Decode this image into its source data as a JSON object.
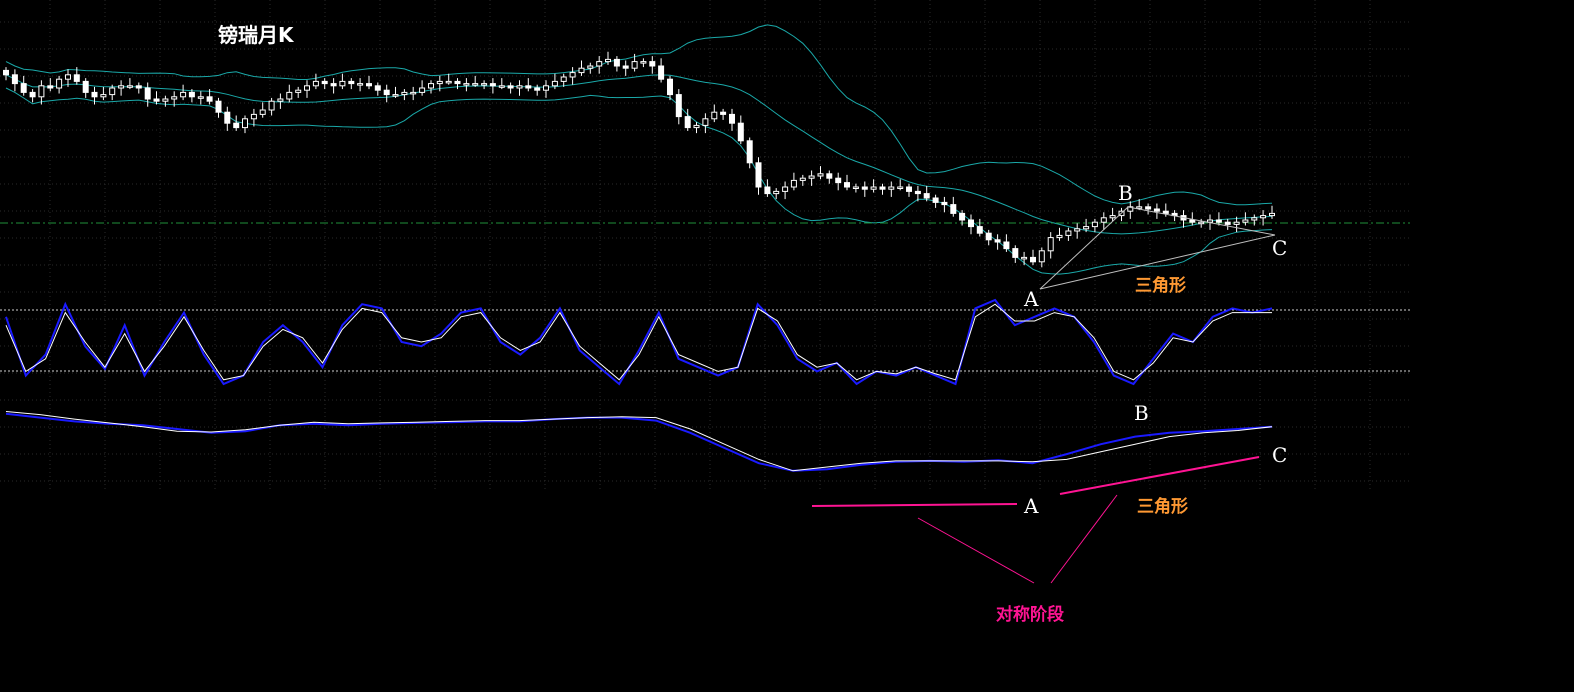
{
  "title": "镑瑞月K",
  "annotations": {
    "triangle_label": "三角形",
    "symmetry_label": "对称阶段",
    "point_a": "A",
    "point_b": "B",
    "point_c": "C"
  },
  "colors": {
    "background": "#000000",
    "candle": "#ffffff",
    "bollinger": "#1aa8a8",
    "grid": "#2a2a2a",
    "reference_line": "#1f8f3a",
    "kd_fast": "#1a1aff",
    "kd_slow": "#ffffff",
    "triangle_label": "#ff9933",
    "symmetry": "#ff1493"
  },
  "chart_data": [
    {
      "type": "candlestick",
      "panel": "price",
      "indicators": [
        "bollinger_bands"
      ],
      "grid": true,
      "horizontal_reference": "dash-dot",
      "close": [
        66,
        62,
        58,
        56,
        61,
        60,
        64,
        66,
        63,
        58,
        56,
        57,
        60,
        61,
        61,
        60,
        55,
        54,
        55,
        56,
        58,
        56,
        56,
        54,
        49,
        44,
        42,
        46,
        48,
        50,
        54,
        55,
        58,
        59,
        61,
        63,
        62,
        61,
        63,
        62,
        62,
        61,
        59,
        57,
        57,
        58,
        58,
        60,
        62,
        63,
        63,
        62,
        62,
        62,
        62,
        61,
        61,
        60,
        61,
        60,
        59,
        61,
        63,
        65,
        67,
        69,
        70,
        72,
        73,
        70,
        69,
        72,
        72,
        70,
        64,
        57,
        47,
        42,
        43,
        46,
        49,
        48,
        44,
        36,
        26,
        15,
        12,
        13,
        15,
        18,
        19,
        20,
        21,
        19,
        17,
        15,
        15,
        14,
        15,
        14,
        15,
        15,
        13,
        12,
        10,
        8,
        7,
        3,
        0,
        -3,
        -6,
        -9,
        -10,
        -13,
        -17,
        -17,
        -19,
        -14,
        -8,
        -7,
        -5,
        -4,
        -3,
        -1,
        1,
        2,
        4,
        6,
        6,
        5,
        4,
        3,
        2,
        0,
        -1,
        -1,
        0,
        -1,
        -2,
        -1,
        0,
        1,
        2,
        3
      ]
    },
    {
      "type": "line",
      "panel": "kd_oscillator",
      "series": [
        {
          "values": [
            0.8,
            0.1,
            0.35,
            0.95,
            0.45,
            0.18,
            0.7,
            0.1,
            0.5,
            0.85,
            0.35,
            0.0,
            0.1,
            0.5,
            0.7,
            0.5,
            0.2,
            0.7,
            0.95,
            0.9,
            0.5,
            0.45,
            0.6,
            0.85,
            0.9,
            0.5,
            0.35,
            0.55,
            0.9,
            0.4,
            0.2,
            0.0,
            0.4,
            0.85,
            0.3,
            0.2,
            0.1,
            0.2,
            0.95,
            0.7,
            0.3,
            0.15,
            0.25,
            0.0,
            0.15,
            0.1,
            0.2,
            0.1,
            0.0,
            0.9,
            1.0,
            0.7,
            0.8,
            0.9,
            0.8,
            0.5,
            0.1,
            0.0,
            0.3,
            0.6,
            0.5,
            0.8,
            0.9,
            0.85,
            0.9
          ]
        },
        {
          "values": [
            0.7,
            0.15,
            0.3,
            0.85,
            0.5,
            0.2,
            0.6,
            0.15,
            0.45,
            0.8,
            0.4,
            0.05,
            0.1,
            0.45,
            0.65,
            0.55,
            0.25,
            0.65,
            0.9,
            0.85,
            0.55,
            0.5,
            0.55,
            0.8,
            0.85,
            0.55,
            0.4,
            0.5,
            0.85,
            0.45,
            0.25,
            0.05,
            0.35,
            0.8,
            0.35,
            0.25,
            0.15,
            0.2,
            0.9,
            0.75,
            0.35,
            0.2,
            0.25,
            0.05,
            0.15,
            0.12,
            0.2,
            0.12,
            0.05,
            0.8,
            0.95,
            0.75,
            0.75,
            0.85,
            0.8,
            0.55,
            0.15,
            0.05,
            0.25,
            0.55,
            0.5,
            0.75,
            0.85,
            0.85,
            0.85
          ]
        }
      ],
      "reference_levels": [
        80,
        20
      ]
    },
    {
      "type": "line",
      "panel": "smoothed_oscillator",
      "series": [
        {
          "values": [
            0.95,
            0.9,
            0.85,
            0.82,
            0.8,
            0.75,
            0.7,
            0.72,
            0.8,
            0.82,
            0.8,
            0.82,
            0.83,
            0.84,
            0.85,
            0.85,
            0.88,
            0.9,
            0.9,
            0.86,
            0.7,
            0.5,
            0.3,
            0.2,
            0.22,
            0.28,
            0.32,
            0.33,
            0.32,
            0.34,
            0.3,
            0.42,
            0.55,
            0.65,
            0.7,
            0.72,
            0.75,
            0.78
          ]
        },
        {
          "values": [
            0.98,
            0.94,
            0.88,
            0.83,
            0.78,
            0.72,
            0.71,
            0.74,
            0.8,
            0.84,
            0.82,
            0.83,
            0.84,
            0.85,
            0.86,
            0.86,
            0.88,
            0.9,
            0.91,
            0.9,
            0.75,
            0.55,
            0.35,
            0.2,
            0.25,
            0.3,
            0.33,
            0.33,
            0.33,
            0.33,
            0.32,
            0.35,
            0.45,
            0.55,
            0.65,
            0.7,
            0.73,
            0.78
          ]
        }
      ]
    }
  ]
}
